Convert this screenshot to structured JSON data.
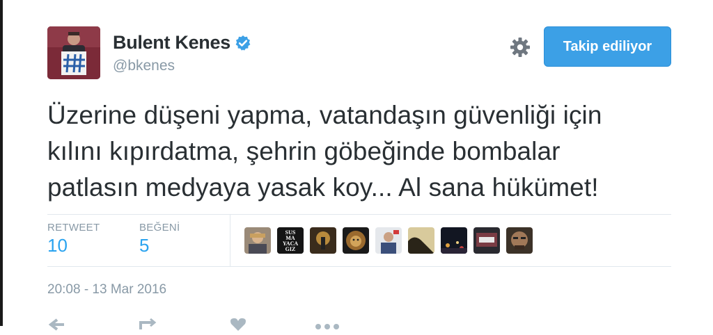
{
  "user": {
    "display_name": "Bulent Kenes",
    "handle": "@bkenes",
    "verified": true
  },
  "follow_button": {
    "label": "Takip ediliyor"
  },
  "tweet": {
    "text_lines": [
      "Üzerine düşeni yapma, vatandaşın güvenliği için",
      "kılını kıpırdatma, şehrin göbeğinde bombalar",
      "patlasın medyaya yasak koy... Al sana hükümet!"
    ]
  },
  "stats": {
    "retweet_label": "RETWEET",
    "retweet_count": "10",
    "like_label": "BEĞENİ",
    "like_count": "5"
  },
  "likers": [
    "liker-avatar",
    "susmayacagiz-avatar",
    "liker-avatar",
    "lion-avatar",
    "liker-avatar",
    "liker-avatar",
    "liker-avatar",
    "liker-avatar",
    "liker-avatar"
  ],
  "liker_badge_text": [
    "SUS",
    "MA",
    "YACA",
    "GIZ"
  ],
  "timestamp": "20:08 - 13 Mar 2016",
  "colors": {
    "accent": "#3ca0e6",
    "count": "#2aa3ef",
    "muted": "#8899a6",
    "verified": "#1da1f2"
  }
}
